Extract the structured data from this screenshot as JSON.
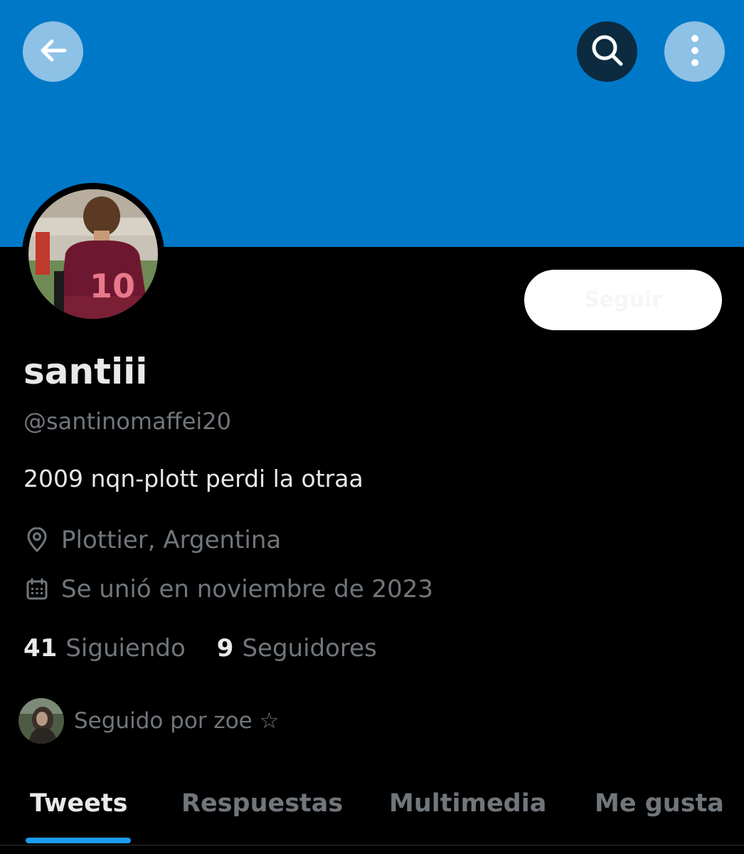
{
  "colors": {
    "banner": "#0078c8",
    "background": "#000000",
    "primary_text": "#e7e9ea",
    "secondary_text": "#71767b",
    "accent": "#1d9bf0"
  },
  "header": {
    "back_icon": "arrow-left-icon",
    "search_icon": "search-icon",
    "more_icon": "more-vertical-icon"
  },
  "profile": {
    "display_name": "santiii",
    "handle": "@santinomaffei20",
    "bio": "2009 nqn-plott perdi la otraa",
    "location": "Plottier, Argentina",
    "joined": "Se unió en noviembre de 2023",
    "follow_label": "Seguir",
    "avatar_jersey_number": "10"
  },
  "stats": {
    "following_count": "41",
    "following_label": "Siguiendo",
    "followers_count": "9",
    "followers_label": "Seguidores"
  },
  "followed_by": {
    "text": "Seguido por zoe ☆"
  },
  "tabs": [
    {
      "label": "Tweets",
      "active": true
    },
    {
      "label": "Respuestas",
      "active": false
    },
    {
      "label": "Multimedia",
      "active": false
    },
    {
      "label": "Me gusta",
      "active": false
    }
  ]
}
